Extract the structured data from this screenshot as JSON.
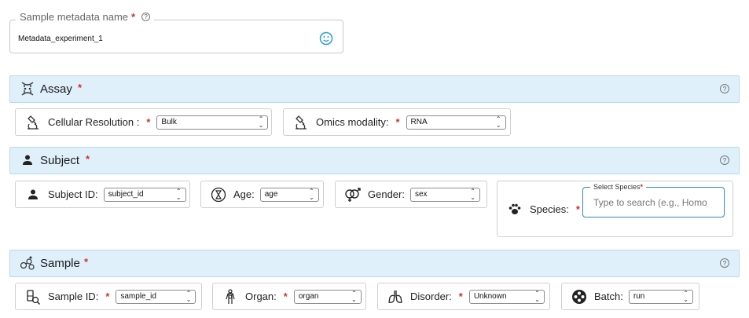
{
  "metadata_name": {
    "label": "Sample metadata name",
    "required_mark": "*",
    "help": "?",
    "value": "Metadata_experiment_1"
  },
  "sections": {
    "assay": {
      "title": "Assay",
      "required_mark": "*",
      "help": "?",
      "fields": {
        "cellular_resolution": {
          "label": "Cellular Resolution :",
          "required_mark": "*",
          "value": "Bulk"
        },
        "omics_modality": {
          "label": "Omics modality:",
          "required_mark": "*",
          "value": "RNA"
        }
      }
    },
    "subject": {
      "title": "Subject",
      "required_mark": "*",
      "help": "?",
      "fields": {
        "subject_id": {
          "label": "Subject ID:",
          "value": "subject_id"
        },
        "age": {
          "label": "Age:",
          "value": "age"
        },
        "gender": {
          "label": "Gender:",
          "value": "sex"
        },
        "species": {
          "label": "Species:",
          "required_mark": "*",
          "legend": "Select Species",
          "legend_mark": "*",
          "placeholder": "Type to search (e.g., Homo"
        }
      }
    },
    "sample": {
      "title": "Sample",
      "required_mark": "*",
      "help": "?",
      "fields": {
        "sample_id": {
          "label": "Sample ID:",
          "required_mark": "*",
          "value": "sample_id"
        },
        "organ": {
          "label": "Organ:",
          "required_mark": "*",
          "value": "organ"
        },
        "disorder": {
          "label": "Disorder:",
          "required_mark": "*",
          "value": "Unknown"
        },
        "batch": {
          "label": "Batch:",
          "value": "run"
        }
      }
    }
  },
  "icons": {
    "metadata_name": "smiley-face-icon",
    "assay": "dna-icon",
    "subject": "person-icon",
    "sample": "molecules-icon",
    "cellular_resolution": "microscope-icon",
    "omics_modality": "microscope-icon",
    "age": "hourglass-icon",
    "gender": "gender-icon",
    "species": "paw-icon",
    "sample_id": "test-tube-icon",
    "organ": "body-organ-icon",
    "disorder": "lungs-icon",
    "batch": "batch-dots-icon"
  },
  "colors": {
    "section_background": "#dff0fb",
    "required": "#d32f2f",
    "focus_accent": "#2a8bc4"
  }
}
